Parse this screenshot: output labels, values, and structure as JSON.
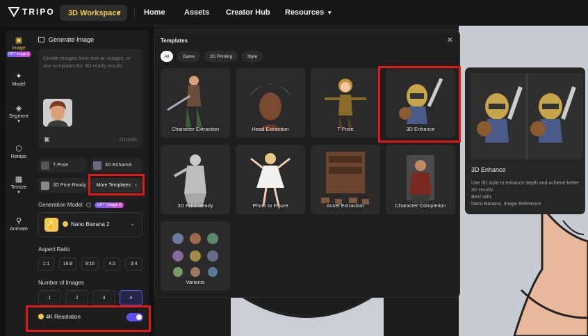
{
  "nav": {
    "brand": "TRIPO",
    "workspace_button": "3D Workspace",
    "items": [
      "Home",
      "Assets",
      "Creator Hub",
      "Resources"
    ]
  },
  "rail": {
    "items": [
      {
        "label": "Image",
        "badge": "GPT Image 2",
        "icon": "image-icon"
      },
      {
        "label": "Model",
        "icon": "sparkle-icon"
      },
      {
        "label": "Segment",
        "icon": "cube-icon"
      },
      {
        "label": "Retopo",
        "icon": "mesh-icon"
      },
      {
        "label": "Texture",
        "icon": "texture-icon"
      },
      {
        "label": "Animate",
        "icon": "figure-icon"
      }
    ]
  },
  "panel": {
    "title": "Generate Image",
    "prompt_placeholder": "Create images from text or images, or use templates for 3D-ready results",
    "char_counter": "0/10000",
    "template_chips": [
      "T Pose",
      "3D Enhance",
      "3D Print-Ready"
    ],
    "more_templates": "More Templates",
    "generation_model_label": "Generation Model",
    "generation_model_badge": "GPT Image 2",
    "model_name": "Nano Banana 2",
    "aspect_ratio_label": "Aspect Ratio",
    "aspect_ratios": [
      "1:1",
      "16:9",
      "9:16",
      "4:3",
      "3:4"
    ],
    "num_images_label": "Number of Images",
    "num_images": [
      "1",
      "2",
      "3",
      "4"
    ],
    "num_images_selected": "4",
    "resolution_label": "4K Resolution",
    "resolution_enabled": true
  },
  "modal": {
    "title": "Templates",
    "filters": [
      "All",
      "Game",
      "3D Printing",
      "Style"
    ],
    "selected_filter": "All",
    "cards": [
      "Character Extraction",
      "Head Extraction",
      "T Pose",
      "3D Enhance",
      "3D Print-Ready",
      "Photo to Figure",
      "Asset Extraction",
      "Character Completion",
      "Variants"
    ]
  },
  "preview": {
    "title": "3D Enhance",
    "description": "Use 3D style to enhance depth and achieve better 3D results",
    "best_with_label": "Best with:",
    "best_with_value": "Nano Banana, Image Reference"
  },
  "colors": {
    "accent": "#f2c94c",
    "highlight_box": "#e01818",
    "toggle": "#5b4ff0"
  }
}
